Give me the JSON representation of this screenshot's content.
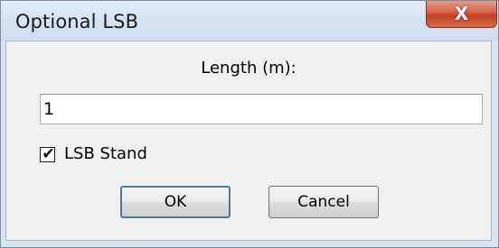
{
  "window": {
    "title": "Optional LSB",
    "close_glyph": "X"
  },
  "form": {
    "length_label": "Length (m):",
    "length_value": "1",
    "lsb_stand_label": "LSB Stand",
    "lsb_stand_checked": true,
    "check_glyph": "✔"
  },
  "buttons": {
    "ok_label": "OK",
    "cancel_label": "Cancel"
  },
  "colors": {
    "close_button": "#c2401f",
    "title_bar": "#d6e2f0",
    "client_background": "#f0f0f0"
  },
  "icons": {
    "close": "close-icon",
    "check": "check-icon"
  }
}
